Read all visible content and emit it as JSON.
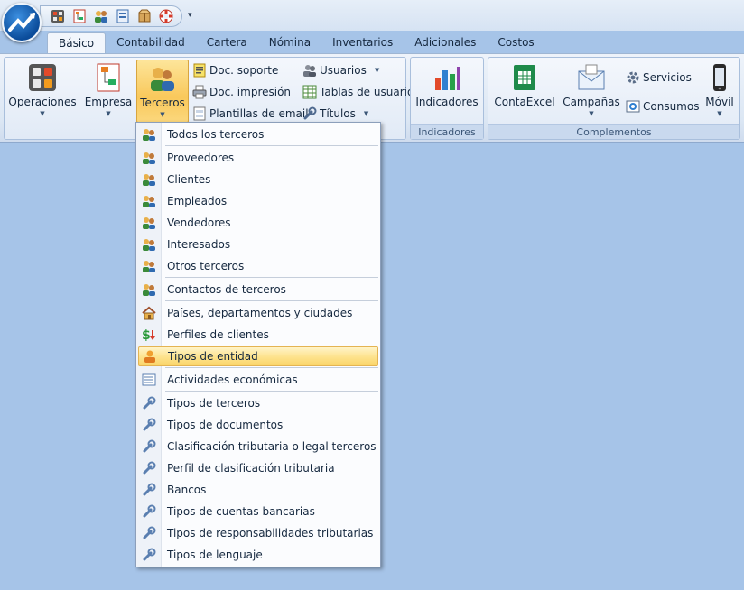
{
  "ribbon": {
    "tabs": [
      "Básico",
      "Contabilidad",
      "Cartera",
      "Nómina",
      "Inventarios",
      "Adicionales",
      "Costos"
    ],
    "active_tab": "Básico",
    "groups": {
      "basico": {
        "operaciones": "Operaciones",
        "empresa": "Empresa",
        "terceros": "Terceros",
        "doc_soporte": "Doc. soporte",
        "doc_impresion": "Doc. impresión",
        "plantillas_email": "Plantillas de email",
        "usuarios": "Usuarios",
        "tablas_usuario": "Tablas de usuario",
        "titulos": "Títulos"
      },
      "indicadores": {
        "label": "Indicadores",
        "btn": "Indicadores"
      },
      "complementos": {
        "label": "Complementos",
        "contaexcel": "ContaExcel",
        "campanas": "Campañas",
        "servicios": "Servicios",
        "consumos": "Consumos",
        "movil": "Móvil"
      }
    }
  },
  "menu": {
    "items": [
      {
        "label": "Todos los terceros",
        "icon": "people-icon"
      },
      {
        "label": "Proveedores",
        "icon": "people-icon"
      },
      {
        "label": "Clientes",
        "icon": "people-icon"
      },
      {
        "label": "Empleados",
        "icon": "people-icon"
      },
      {
        "label": "Vendedores",
        "icon": "people-icon"
      },
      {
        "label": "Interesados",
        "icon": "people-icon"
      },
      {
        "label": "Otros terceros",
        "icon": "people-icon"
      },
      {
        "label": "Contactos de terceros",
        "icon": "people-icon"
      },
      {
        "label": "Países, departamentos y ciudades",
        "icon": "house-icon"
      },
      {
        "label": "Perfiles de clientes",
        "icon": "dollar-icon"
      },
      {
        "label": "Tipos de entidad",
        "icon": "person-icon"
      },
      {
        "label": "Actividades económicas",
        "icon": "list-icon"
      },
      {
        "label": "Tipos de terceros",
        "icon": "wrench-icon"
      },
      {
        "label": "Tipos de documentos",
        "icon": "wrench-icon"
      },
      {
        "label": "Clasificación tributaria o legal terceros",
        "icon": "wrench-icon"
      },
      {
        "label": "Perfil de clasificación tributaria",
        "icon": "wrench-icon"
      },
      {
        "label": "Bancos",
        "icon": "wrench-icon"
      },
      {
        "label": "Tipos de cuentas bancarias",
        "icon": "wrench-icon"
      },
      {
        "label": "Tipos de responsabilidades tributarias",
        "icon": "wrench-icon"
      },
      {
        "label": "Tipos de lenguaje",
        "icon": "wrench-icon"
      }
    ],
    "highlighted": "Tipos de entidad"
  },
  "colors": {
    "background": "#a6c4e8",
    "highlight": "#fde28c",
    "ribbon": "#dce7f4"
  }
}
